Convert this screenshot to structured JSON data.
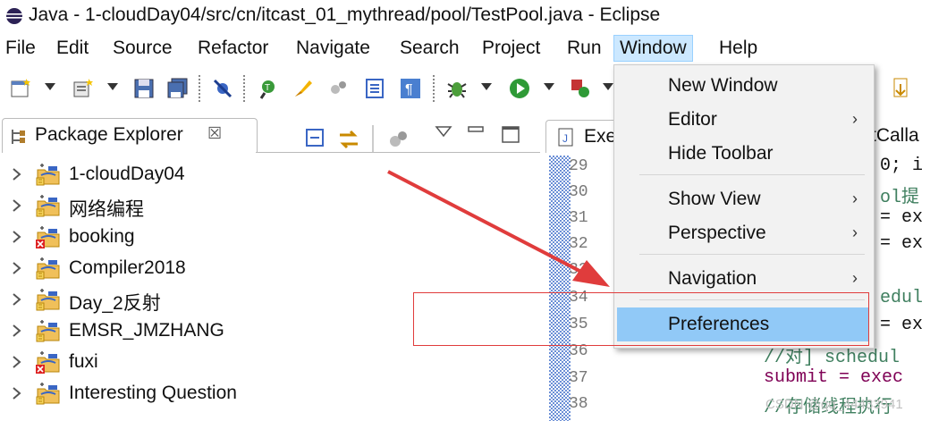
{
  "window": {
    "title": "Java - 1-cloudDay04/src/cn/itcast_01_mythread/pool/TestPool.java - Eclipse"
  },
  "menubar": [
    "File",
    "Edit",
    "Source",
    "Refactor",
    "Navigate",
    "Search",
    "Project",
    "Run",
    "Window",
    "Help"
  ],
  "window_menu": {
    "items": [
      "New Window",
      "Editor",
      "Hide Toolbar",
      "Show View",
      "Perspective",
      "Navigation",
      "Preferences"
    ],
    "submenu_glyph": "›",
    "selected": "Preferences"
  },
  "package_explorer": {
    "tab_title": "Package Explorer",
    "close_glyph": "☒",
    "projects": [
      {
        "name": "1-cloudDay04",
        "error": false
      },
      {
        "name": "网络编程",
        "error": false
      },
      {
        "name": "booking",
        "error": true
      },
      {
        "name": "Compiler2018",
        "error": false
      },
      {
        "name": "Day_2反射",
        "error": false
      },
      {
        "name": "EMSR_JMZHANG",
        "error": false
      },
      {
        "name": "fuxi",
        "error": true
      },
      {
        "name": "Interesting Question",
        "error": false
      }
    ]
  },
  "editor": {
    "tab_title": "Exe",
    "second_tab_title": "tCalla",
    "line_numbers": [
      "29",
      "30",
      "31",
      "32",
      "33",
      "34",
      "35",
      "36",
      "37",
      "38"
    ],
    "code_fragments": {
      "l29": "0; i",
      "l30": "ol提",
      "l31": "= ex",
      "l32": "= ex",
      "l34": "edul",
      "l35": "= ex",
      "l36": "//对] schedul",
      "l37": "submit = exec",
      "l38": "//存储线程执行"
    }
  },
  "watermark": "CSDN @qq_44433941",
  "colors": {
    "menu_highlight": "#91c9f7",
    "annotation_red": "#e03c3c",
    "keyword_purple": "#7f0055"
  }
}
